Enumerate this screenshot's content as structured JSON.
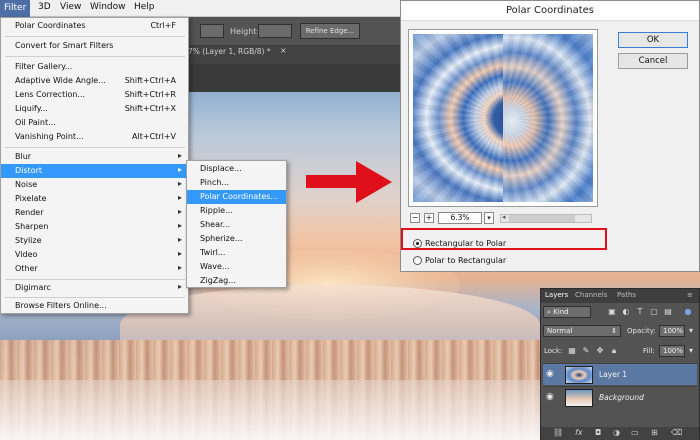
{
  "menubar": {
    "items": [
      "Filter",
      "3D",
      "View",
      "Window",
      "Help"
    ]
  },
  "options_bar": {
    "height_label": "Height:",
    "refine_edge": "Refine Edge..."
  },
  "document_tab": {
    "title": "7% (Layer 1, RGB/8) *",
    "close": "×"
  },
  "filter_menu": {
    "items": [
      {
        "label": "Polar Coordinates",
        "shortcut": "Ctrl+F"
      },
      {
        "label": "Convert for Smart Filters"
      },
      {
        "label": "Filter Gallery..."
      },
      {
        "label": "Adaptive Wide Angle...",
        "shortcut": "Shift+Ctrl+A"
      },
      {
        "label": "Lens Correction...",
        "shortcut": "Shift+Ctrl+R"
      },
      {
        "label": "Liquify...",
        "shortcut": "Shift+Ctrl+X"
      },
      {
        "label": "Oil Paint..."
      },
      {
        "label": "Vanishing Point...",
        "shortcut": "Alt+Ctrl+V"
      },
      {
        "label": "Blur"
      },
      {
        "label": "Distort"
      },
      {
        "label": "Noise"
      },
      {
        "label": "Pixelate"
      },
      {
        "label": "Render"
      },
      {
        "label": "Sharpen"
      },
      {
        "label": "Stylize"
      },
      {
        "label": "Video"
      },
      {
        "label": "Other"
      },
      {
        "label": "Digimarc"
      },
      {
        "label": "Browse Filters Online..."
      }
    ]
  },
  "distort_submenu": {
    "items": [
      "Displace...",
      "Pinch...",
      "Polar Coordinates...",
      "Ripple...",
      "Shear...",
      "Spherize...",
      "Twirl...",
      "Wave...",
      "ZigZag..."
    ]
  },
  "dialog": {
    "title": "Polar Coordinates",
    "ok": "OK",
    "cancel": "Cancel",
    "zoom_minus": "−",
    "zoom_plus": "+",
    "zoom_value": "6.3%",
    "option_rect_to_polar": "Rectangular to Polar",
    "option_polar_to_rect": "Polar to Rectangular"
  },
  "layers_panel": {
    "tabs": [
      "Layers",
      "Channels",
      "Paths"
    ],
    "filter_kind": "Kind",
    "blend_mode": "Normal",
    "opacity_label": "Opacity:",
    "opacity_value": "100%",
    "lock_label": "Lock:",
    "fill_label": "Fill:",
    "fill_value": "100%",
    "layers": [
      {
        "name": "Layer 1"
      },
      {
        "name": "Background"
      }
    ]
  }
}
